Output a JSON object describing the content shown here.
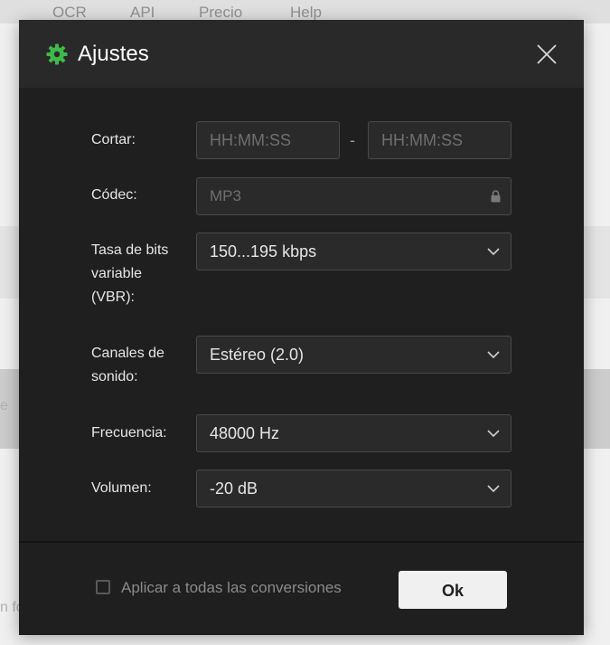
{
  "background": {
    "nav_items": [
      "OCR",
      "API",
      "Precio",
      "Help"
    ],
    "band_text": "e",
    "footer_text": "n fo"
  },
  "dialog": {
    "title": "Ajustes",
    "icons": {
      "title_icon": "gear-icon",
      "close": "close-icon",
      "locked": "lock-icon",
      "dropdown": "chevron-down-icon"
    },
    "accent_color": "#3fba4a"
  },
  "form": {
    "cut": {
      "label": "Cortar:",
      "start_placeholder": "HH:MM:SS",
      "separator": "-",
      "end_placeholder": "HH:MM:SS"
    },
    "codec": {
      "label": "Códec:",
      "value": "MP3"
    },
    "vbr": {
      "label": "Tasa de bits variable (VBR):",
      "value": "150...195 kbps"
    },
    "channels": {
      "label": "Canales de sonido:",
      "value": "Estéreo (2.0)"
    },
    "frequency": {
      "label": "Frecuencia:",
      "value": "48000 Hz"
    },
    "volume": {
      "label": "Volumen:",
      "value": "-20 dB"
    }
  },
  "footer": {
    "apply_all_label": "Aplicar a todas las conversiones",
    "apply_all_checked": false,
    "ok_label": "Ok"
  }
}
